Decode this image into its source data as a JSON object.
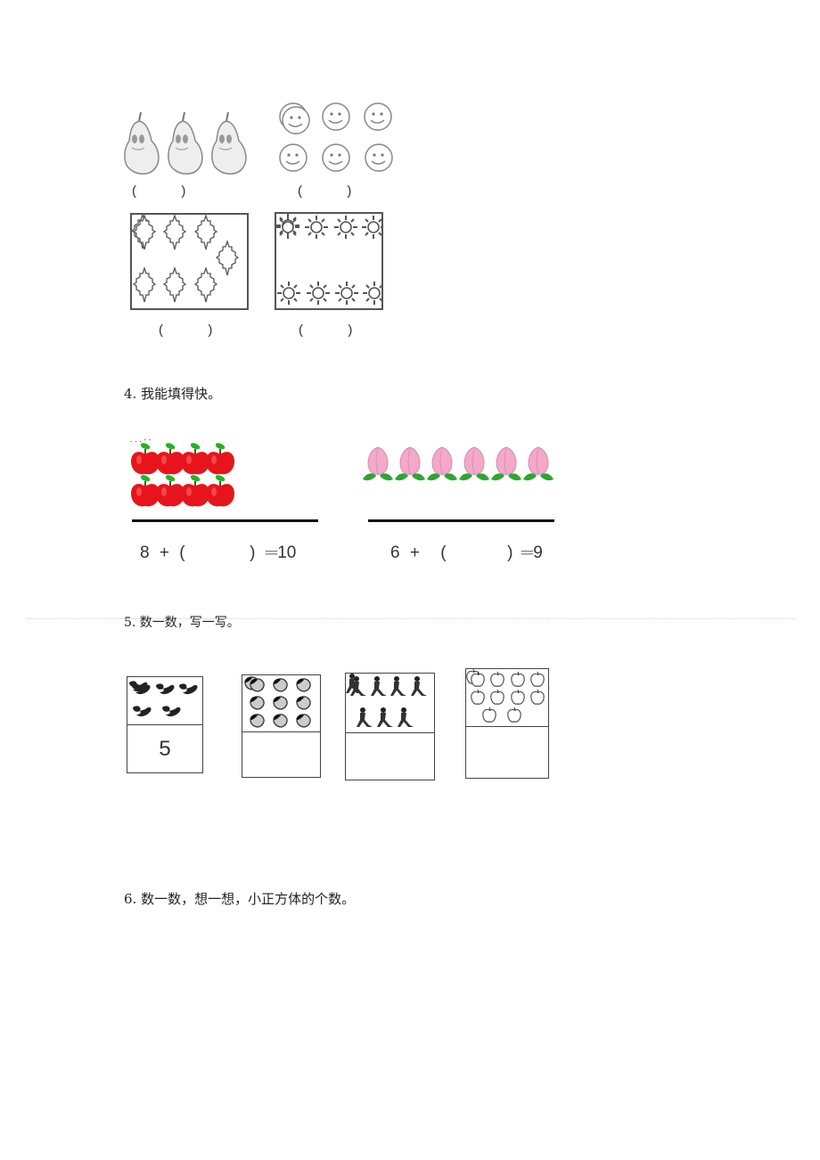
{
  "section3": {
    "groups": [
      {
        "name": "pears",
        "icon": "pear-icon",
        "count": 3,
        "answer_open": "(",
        "answer_close": ")"
      },
      {
        "name": "smiley-faces",
        "icon": "smiley-icon",
        "count": 6,
        "answer_open": "(",
        "answer_close": ")"
      },
      {
        "name": "diamond-shapes",
        "icon": "diamond-ornament-icon",
        "count": 7,
        "answer_open": "(",
        "answer_close": ")"
      },
      {
        "name": "suns",
        "icon": "sun-icon",
        "count": 8,
        "answer_open": "(",
        "answer_close": ")"
      }
    ]
  },
  "question4": {
    "title": "4. 我能填得快。",
    "left": {
      "icon": "apple-icon",
      "picture_count": 8,
      "equation": {
        "a": "8",
        "op": "+",
        "open": "(",
        "close": ")",
        "eq": "═",
        "result": "10"
      }
    },
    "right": {
      "icon": "peach-icon",
      "picture_count": 6,
      "equation": {
        "a": "6",
        "op": "+",
        "open": "(",
        "close": ")",
        "eq": "═",
        "result": "9"
      }
    }
  },
  "question5": {
    "title": "5. 数一数，写一写。",
    "boxes": [
      {
        "icon": "bird-icon",
        "picture_count": 5,
        "answer": "5"
      },
      {
        "icon": "strawberry-icon",
        "picture_count": 9,
        "answer": ""
      },
      {
        "icon": "figure-icon",
        "picture_count": 7,
        "answer": ""
      },
      {
        "icon": "apple-outline-icon",
        "picture_count": 10,
        "answer": ""
      }
    ]
  },
  "question6": {
    "title": "6. 数一数，想一想，小正方体的个数。"
  },
  "colors": {
    "apple_red": "#e8141c",
    "leaf_green": "#22b322",
    "peach_pink": "#f3a9c9",
    "line_gray": "#555555"
  }
}
